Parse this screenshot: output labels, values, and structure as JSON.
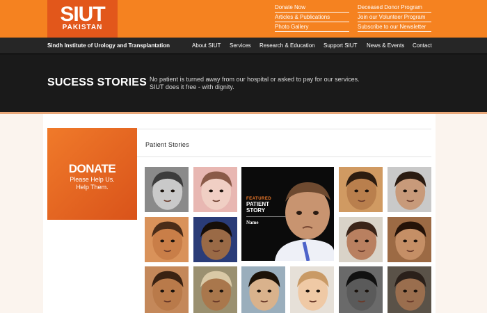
{
  "logo": {
    "main": "SIUT",
    "sub": "PAKISTAN"
  },
  "top_links": [
    "Donate Now",
    "Articles & Publications",
    "Photo Gallery",
    "Deceased Donor Program",
    "Join our Volunteer Program",
    "Subscribe to our Newsletter"
  ],
  "nav": {
    "institute": "Sindh Institute of Urology and Transplantation",
    "items": [
      "About SIUT",
      "Services",
      "Research & Education",
      "Support SIUT",
      "News & Events",
      "Contact"
    ]
  },
  "banner": {
    "title": "SUCESS STORIES",
    "desc_line1": "No patient is turned away from our hospital or asked to pay for our services.",
    "desc_line2": "SIUT does it free - with dignity."
  },
  "donate": {
    "title": "DONATE",
    "line1": "Please Help Us.",
    "line2": "Help Them."
  },
  "section": {
    "title": "Patient Stories"
  },
  "featured": {
    "label": "FEATURED",
    "line1": "PATIENT",
    "line2": "STORY",
    "name": "Name"
  },
  "colors": {
    "brand_orange": "#f58220",
    "logo_orange": "#e2571b",
    "nav_dark": "#262626",
    "banner_dark": "#1a1a1a"
  },
  "photos": [
    {
      "name": "photo-girl-bw",
      "bg": "#8a8a8a",
      "skin": "#c9c9c9",
      "hair": "#3c3c3c"
    },
    {
      "name": "photo-crying-baby",
      "bg": "#e8b7b2",
      "skin": "#f0cfc4",
      "hair": "#8a5a48"
    },
    {
      "name": "photo-boy-bed",
      "bg": "#d09a62",
      "skin": "#b97f4d",
      "hair": "#2c1c10"
    },
    {
      "name": "photo-child-sleeping",
      "bg": "#c9c9c9",
      "skin": "#c89a7a",
      "hair": "#2a1b12"
    },
    {
      "name": "photo-girl-closeup",
      "bg": "#d9925a",
      "skin": "#c97e48",
      "hair": "#4a2c18"
    },
    {
      "name": "photo-boy-blue",
      "bg": "#2a3c78",
      "skin": "#9a6a46",
      "hair": "#160e08"
    },
    {
      "name": "photo-woman-smiling",
      "bg": "#d9d3c8",
      "skin": "#b98060",
      "hair": "#3a2418"
    },
    {
      "name": "photo-child-heart",
      "bg": "#9c6a44",
      "skin": "#c58f66",
      "hair": "#241208"
    },
    {
      "name": "photo-boy-closeup",
      "bg": "#c4885a",
      "skin": "#b97a4a",
      "hair": "#3a2212"
    },
    {
      "name": "photo-woman-scarf",
      "bg": "#9a9070",
      "skin": "#a9774c",
      "hair": "#d9c9a6"
    },
    {
      "name": "photo-baby-bed",
      "bg": "#9aaebc",
      "skin": "#d9b28c",
      "hair": "#1c1208"
    },
    {
      "name": "photo-baby-smiling",
      "bg": "#e6e0d8",
      "skin": "#efc9a5",
      "hair": "#c99a66"
    },
    {
      "name": "photo-girl-laughing-bw",
      "bg": "#6a6a6a",
      "skin": "#5a5a5a",
      "hair": "#111111"
    },
    {
      "name": "photo-old-woman",
      "bg": "#5a5248",
      "skin": "#9a6e4e",
      "hair": "#2a201a"
    }
  ]
}
